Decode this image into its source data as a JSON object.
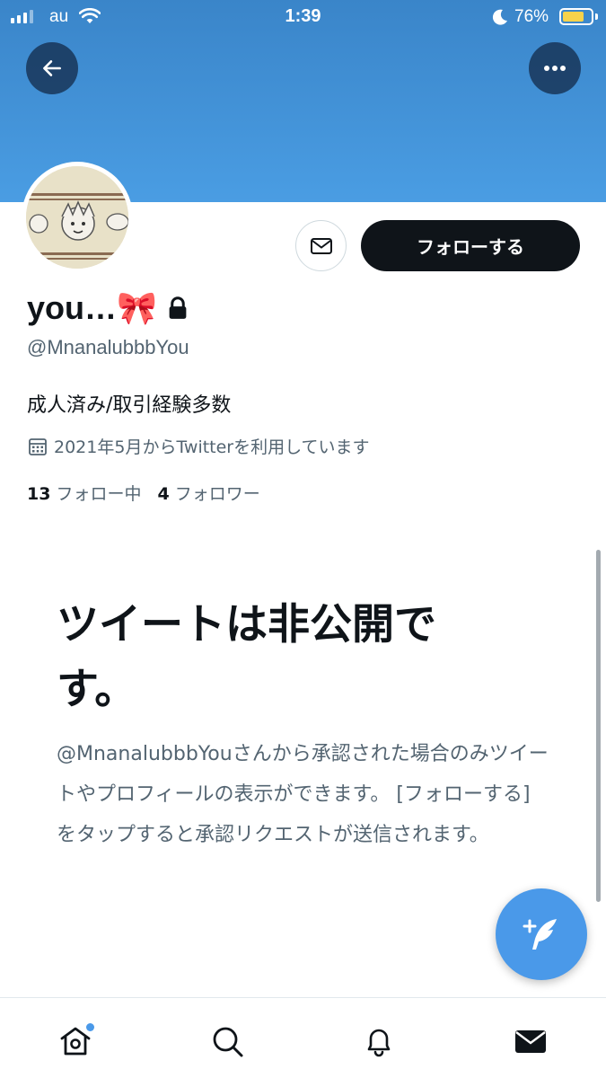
{
  "status_bar": {
    "carrier": "au",
    "time": "1:39",
    "battery_percent": "76%",
    "battery_level": 0.76,
    "battery_color": "#f7d24b",
    "icons": [
      "signal-icon",
      "wifi-icon",
      "moon-icon",
      "battery-icon"
    ]
  },
  "header": {
    "banner_color": "#4a9de3",
    "back_icon": "arrow-left-icon",
    "more_icon": "more-horizontal-icon"
  },
  "profile": {
    "display_name": "you…🎀",
    "protected_icon": "lock-icon",
    "handle": "@MnanalubbbYou",
    "bio": "成人済み/取引経験多数",
    "joined_icon": "calendar-icon",
    "joined": "2021年5月からTwitterを利用しています",
    "following_count": "13",
    "following_label": "フォロー中",
    "followers_count": "4",
    "followers_label": "フォロワー"
  },
  "actions": {
    "message_icon": "envelope-icon",
    "follow_label": "フォローする"
  },
  "private_notice": {
    "title": "ツイートは非公開です。",
    "description": "@MnanalubbbYouさんから承認された場合のみツイートやプロフィールの表示ができます。 [フォローする] をタップすると承認リクエストが送信されます。"
  },
  "compose": {
    "icon": "compose-tweet-icon",
    "color": "#4a99e9"
  },
  "tab_bar": {
    "tabs": [
      {
        "name": "home",
        "icon": "home-icon",
        "has_new": true
      },
      {
        "name": "search",
        "icon": "search-icon"
      },
      {
        "name": "notifications",
        "icon": "bell-icon"
      },
      {
        "name": "messages",
        "icon": "envelope-icon"
      }
    ]
  }
}
